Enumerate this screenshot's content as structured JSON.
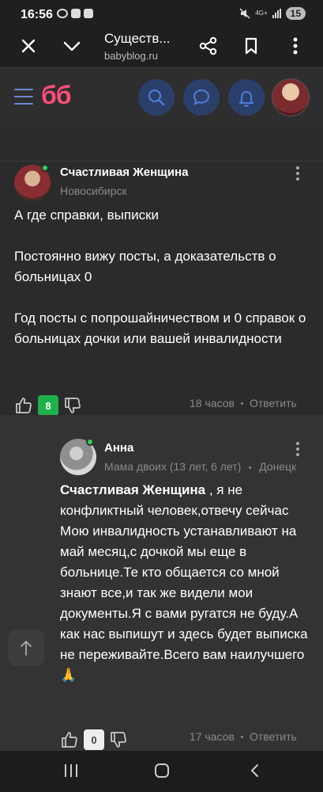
{
  "status_bar": {
    "time": "16:56",
    "network": "4G+",
    "battery": "15"
  },
  "browser": {
    "title": "Существ...",
    "url": "babyblog.ru",
    "icons": [
      "close-icon",
      "chevron-down-icon",
      "share-icon",
      "bookmark-icon",
      "more-vert-icon"
    ]
  },
  "site_header": {
    "logo": "бб",
    "icons": [
      "menu-icon",
      "search-icon",
      "chat-icon",
      "bell-icon"
    ]
  },
  "comments": [
    {
      "author": "Счастливая Женщина",
      "subtitle": "Новосибирск",
      "text": "А где справки, выписки\n\nПостоянно вижу посты, а доказательств о больницах 0\n\nГод посты с попрошайничеством и 0 справок о больницах дочки или вашей инвалидности",
      "likes": "8",
      "time": "18 часов",
      "reply_label": "Ответить"
    },
    {
      "author": "Анна",
      "subtitle": "Мама двоих (13 лет, 6 лет)",
      "location": "Донецк",
      "mention": "Счастливая Женщина",
      "text": " , я не конфликтный человек,отвечу сейчас Мою инвалидность устанавливают на май месяц,с дочкой мы еще в больнице.Те кто общается со мной знают все,и так же видели мои документы.Я с вами ругатся не буду.А как нас выпишут и здесь будет выписка не переживайте.Всего вам наилучшего 🙏",
      "likes": "0",
      "time": "17 часов",
      "reply_label": "Ответить"
    }
  ],
  "colors": {
    "brand": "#ff4d7a",
    "accent": "#2b3f6b",
    "like_badge": "#20b04b",
    "online": "#2fd15b"
  }
}
